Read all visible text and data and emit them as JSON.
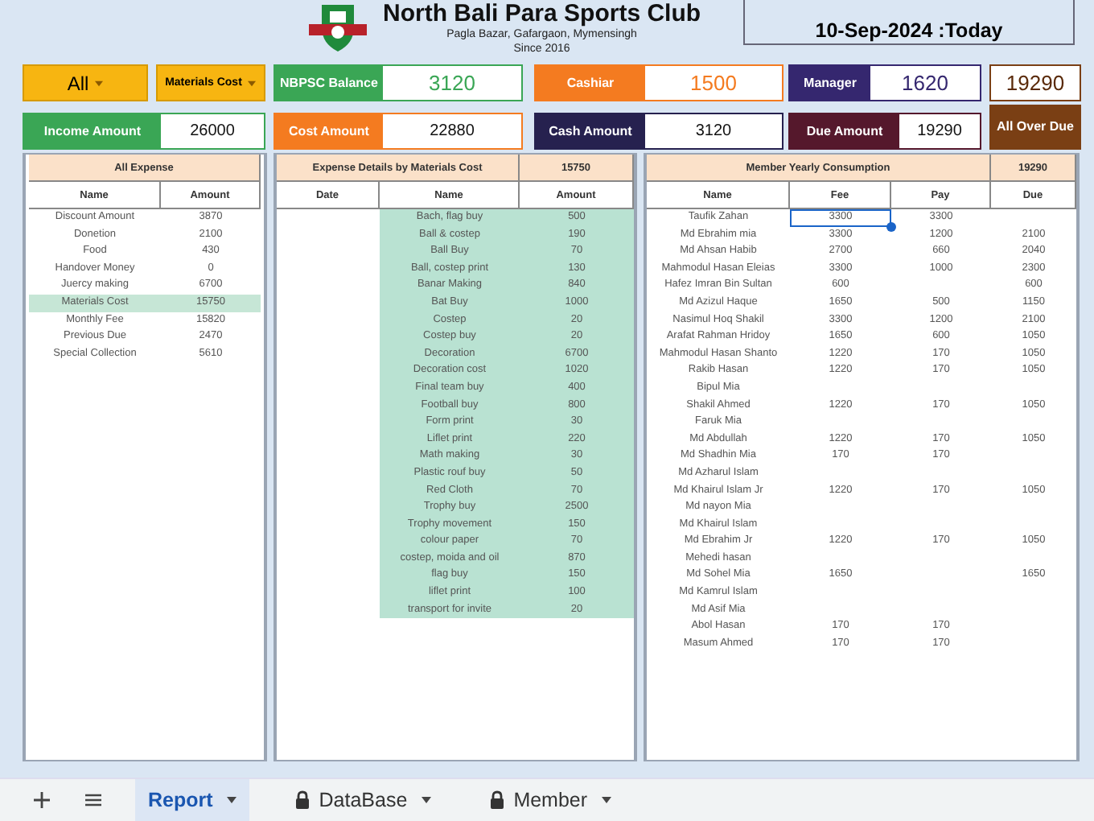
{
  "header": {
    "title": "North Bali Para Sports Club",
    "address": "Pagla Bazar, Gafargaon, Mymensingh",
    "since": "Since 2016"
  },
  "date": "10-Sep-2024 :Today",
  "filters": [
    {
      "label": "All"
    },
    {
      "label": "Materials Cost"
    }
  ],
  "top_cards": [
    {
      "label": "NBPSC Balance",
      "value": "3120",
      "color": "#3aa655"
    },
    {
      "label": "Cashiar",
      "value": "1500",
      "color": "#f47b20"
    },
    {
      "label": "Manager",
      "value": "1620",
      "color": "#35276f"
    }
  ],
  "bottom_cards": [
    {
      "label": "Income Amount",
      "value": "26000",
      "color": "#3aa655"
    },
    {
      "label": "Cost Amount",
      "value": "22880",
      "color": "#f47b20"
    },
    {
      "label": "Cash Amount",
      "value": "3120",
      "color": "#26214f"
    },
    {
      "label": "Due Amount",
      "value": "19290",
      "color": "#55182c"
    }
  ],
  "overall": {
    "value": "19290",
    "label": "All Over Due"
  },
  "all_expense": {
    "title": "All Expense",
    "columns": [
      "Name",
      "Amount"
    ],
    "rows": [
      {
        "name": "Discount Amount",
        "amount": "3870",
        "selected": false
      },
      {
        "name": "Donetion",
        "amount": "2100",
        "selected": false
      },
      {
        "name": "Food",
        "amount": "430",
        "selected": false
      },
      {
        "name": "Handover Money",
        "amount": "0",
        "selected": false
      },
      {
        "name": "Juercy making",
        "amount": "6700",
        "selected": false
      },
      {
        "name": "Materials Cost",
        "amount": "15750",
        "selected": true
      },
      {
        "name": "Monthly Fee",
        "amount": "15820",
        "selected": false
      },
      {
        "name": "Previous Due",
        "amount": "2470",
        "selected": false
      },
      {
        "name": "Special Collection",
        "amount": "5610",
        "selected": false
      }
    ]
  },
  "details": {
    "title": "Expense Details by Materials Cost",
    "total": "15750",
    "columns": [
      "Date",
      "Name",
      "Amount"
    ],
    "rows": [
      {
        "name": "Bach, flag buy",
        "amount": "500"
      },
      {
        "name": "Ball & costep",
        "amount": "190"
      },
      {
        "name": "Ball Buy",
        "amount": "70"
      },
      {
        "name": "Ball, costep print",
        "amount": "130"
      },
      {
        "name": "Banar Making",
        "amount": "840"
      },
      {
        "name": "Bat Buy",
        "amount": "1000"
      },
      {
        "name": "Costep",
        "amount": "20"
      },
      {
        "name": "Costep buy",
        "amount": "20"
      },
      {
        "name": "Decoration",
        "amount": "6700"
      },
      {
        "name": "Decoration cost",
        "amount": "1020"
      },
      {
        "name": "Final team buy",
        "amount": "400"
      },
      {
        "name": "Football buy",
        "amount": "800"
      },
      {
        "name": "Form print",
        "amount": "30"
      },
      {
        "name": "Liflet print",
        "amount": "220"
      },
      {
        "name": "Math making",
        "amount": "30"
      },
      {
        "name": "Plastic rouf buy",
        "amount": "50"
      },
      {
        "name": "Red Cloth",
        "amount": "70"
      },
      {
        "name": "Trophy buy",
        "amount": "2500"
      },
      {
        "name": "Trophy movement",
        "amount": "150"
      },
      {
        "name": "colour paper",
        "amount": "70"
      },
      {
        "name": "costep, moida and oil",
        "amount": "870"
      },
      {
        "name": "flag buy",
        "amount": "150"
      },
      {
        "name": "liflet print",
        "amount": "100"
      },
      {
        "name": "transport for invite",
        "amount": "20"
      }
    ]
  },
  "members": {
    "title": "Member Yearly Consumption",
    "total": "19290",
    "columns": [
      "Name",
      "Fee",
      "Pay",
      "Due"
    ],
    "rows": [
      {
        "name": "Taufik Zahan",
        "fee": "3300",
        "pay": "3300",
        "selected": true
      },
      {
        "name": "Md Ebrahim mia",
        "fee": "3300",
        "pay": "1200",
        "due": "2100",
        "selected": false
      },
      {
        "name": "Md Ahsan Habib",
        "fee": "2700",
        "pay": "660",
        "due": "2040",
        "selected": false
      },
      {
        "name": "Mahmodul Hasan Eleias",
        "fee": "3300",
        "pay": "1000",
        "due": "2300",
        "selected": false
      },
      {
        "name": "Hafez Imran Bin Sultan",
        "fee": "600",
        "due": "600",
        "selected": false
      },
      {
        "name": "Md Azizul Haque",
        "fee": "1650",
        "pay": "500",
        "due": "1150",
        "selected": false
      },
      {
        "name": "Nasimul Hoq Shakil",
        "fee": "3300",
        "pay": "1200",
        "due": "2100",
        "selected": false
      },
      {
        "name": "Arafat Rahman Hridoy",
        "fee": "1650",
        "pay": "600",
        "due": "1050",
        "selected": false
      },
      {
        "name": "Mahmodul Hasan Shanto",
        "fee": "1220",
        "pay": "170",
        "due": "1050",
        "selected": false
      },
      {
        "name": "Rakib Hasan",
        "fee": "1220",
        "pay": "170",
        "due": "1050",
        "selected": false
      },
      {
        "name": "Bipul Mia",
        "selected": false
      },
      {
        "name": "Shakil Ahmed",
        "fee": "1220",
        "pay": "170",
        "due": "1050",
        "selected": false
      },
      {
        "name": "Faruk Mia",
        "selected": false
      },
      {
        "name": "Md Abdullah",
        "fee": "1220",
        "pay": "170",
        "due": "1050",
        "selected": false
      },
      {
        "name": "Md Shadhin Mia",
        "fee": "170",
        "pay": "170",
        "selected": false
      },
      {
        "name": "Md Azharul Islam",
        "selected": false
      },
      {
        "name": "Md Khairul Islam Jr",
        "fee": "1220",
        "pay": "170",
        "due": "1050",
        "selected": false
      },
      {
        "name": "Md nayon Mia",
        "selected": false
      },
      {
        "name": "Md Khairul Islam",
        "selected": false
      },
      {
        "name": "Md Ebrahim Jr",
        "fee": "1220",
        "pay": "170",
        "due": "1050",
        "selected": false
      },
      {
        "name": "Mehedi hasan",
        "selected": false
      },
      {
        "name": "Md Sohel Mia",
        "fee": "1650",
        "due": "1650",
        "selected": false
      },
      {
        "name": "Md Kamrul Islam",
        "selected": false
      },
      {
        "name": "Md Asif Mia",
        "selected": false
      },
      {
        "name": "Abol Hasan",
        "fee": "170",
        "pay": "170",
        "selected": false
      },
      {
        "name": "Masum Ahmed",
        "fee": "170",
        "pay": "170",
        "selected": false
      }
    ]
  },
  "sheet_tabs": [
    {
      "label": "Report",
      "selected": true,
      "locked": false
    },
    {
      "label": "DataBase",
      "selected": false,
      "locked": true
    },
    {
      "label": "Member",
      "selected": false,
      "locked": true
    }
  ]
}
